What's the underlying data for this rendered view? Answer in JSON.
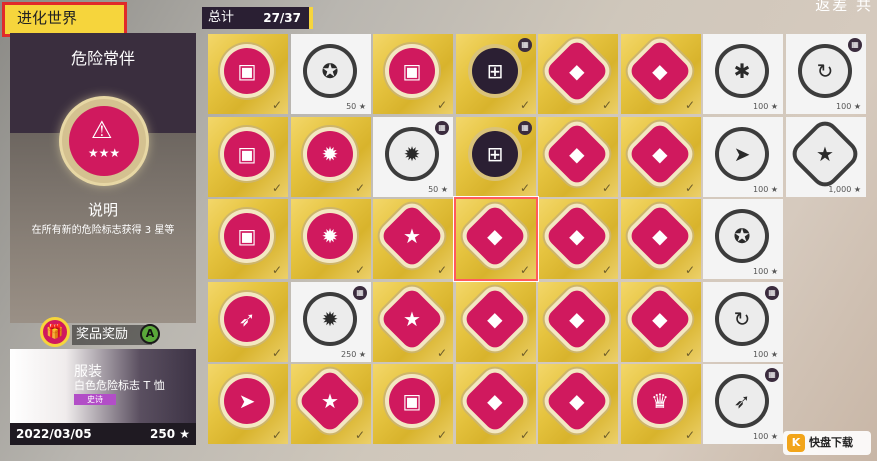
{
  "header": {
    "title": "进化世界",
    "total_label": "总计",
    "total_value": "27/37",
    "corner_text": "返差 共"
  },
  "detail": {
    "title": "危险常伴",
    "badge_icon": "warning-triangle-icon",
    "description_heading": "说明",
    "description_text": "在所有新的危险标志获得 3 星等"
  },
  "reward": {
    "label": "奖品奖励",
    "button_hint": "A",
    "type": "服装",
    "name": "白色危险标志 T 恤",
    "rarity": "史诗",
    "date": "2022/03/05",
    "points": "250 ★"
  },
  "tiles": [
    {
      "style": "gold",
      "badge": "pink",
      "icon": "▣",
      "done": true
    },
    {
      "style": "white",
      "badge": "grey",
      "icon": "✪",
      "pts": "50 ★"
    },
    {
      "style": "gold",
      "badge": "pink",
      "icon": "▣",
      "done": true
    },
    {
      "style": "gold",
      "badge": "dark",
      "icon": "⊞",
      "done": true,
      "gift": true
    },
    {
      "style": "gold",
      "badge": "pink",
      "icon": "◆",
      "shape": "hex",
      "done": true
    },
    {
      "style": "gold",
      "badge": "pink",
      "icon": "◆",
      "shape": "hex",
      "done": true
    },
    {
      "style": "white",
      "badge": "grey",
      "icon": "✱",
      "pts": "100 ★"
    },
    {
      "style": "white",
      "badge": "grey",
      "icon": "↻",
      "pts": "100 ★",
      "gift": true
    },
    {
      "style": "gold",
      "badge": "pink",
      "icon": "▣",
      "done": true
    },
    {
      "style": "gold",
      "badge": "pink",
      "icon": "✹",
      "done": true
    },
    {
      "style": "white",
      "badge": "grey",
      "icon": "✹",
      "pts": "50 ★",
      "gift": true
    },
    {
      "style": "gold",
      "badge": "dark",
      "icon": "⊞",
      "done": true,
      "gift": true
    },
    {
      "style": "gold",
      "badge": "pink",
      "icon": "◆",
      "shape": "hex",
      "done": true
    },
    {
      "style": "gold",
      "badge": "pink",
      "icon": "◆",
      "shape": "hex",
      "done": true
    },
    {
      "style": "white",
      "badge": "grey",
      "icon": "➤",
      "pts": "100 ★"
    },
    {
      "style": "white",
      "badge": "grey",
      "icon": "★",
      "shape": "hex",
      "pts": "1,000 ★"
    },
    {
      "style": "gold",
      "badge": "pink",
      "icon": "▣",
      "done": true
    },
    {
      "style": "gold",
      "badge": "pink",
      "icon": "✹",
      "done": true
    },
    {
      "style": "gold",
      "badge": "pink",
      "icon": "★",
      "shape": "hex",
      "done": true
    },
    {
      "style": "gold",
      "badge": "pink",
      "icon": "◆",
      "shape": "hex",
      "done": true,
      "selected": true
    },
    {
      "style": "gold",
      "badge": "pink",
      "icon": "◆",
      "shape": "hex",
      "done": true
    },
    {
      "style": "gold",
      "badge": "pink",
      "icon": "◆",
      "shape": "hex",
      "done": true
    },
    {
      "style": "white",
      "badge": "grey",
      "icon": "✪",
      "pts": "100 ★"
    },
    null,
    {
      "style": "gold",
      "badge": "pink",
      "icon": "➶",
      "done": true
    },
    {
      "style": "white",
      "badge": "grey",
      "icon": "✹",
      "pts": "250 ★",
      "gift": true
    },
    {
      "style": "gold",
      "badge": "pink",
      "icon": "★",
      "shape": "hex",
      "done": true
    },
    {
      "style": "gold",
      "badge": "pink",
      "icon": "◆",
      "shape": "hex",
      "done": true
    },
    {
      "style": "gold",
      "badge": "pink",
      "icon": "◆",
      "shape": "hex",
      "done": true
    },
    {
      "style": "gold",
      "badge": "pink",
      "icon": "◆",
      "shape": "hex",
      "done": true
    },
    {
      "style": "white",
      "badge": "grey",
      "icon": "↻",
      "pts": "100 ★",
      "gift": true
    },
    null,
    {
      "style": "gold",
      "badge": "pink",
      "icon": "➤",
      "done": true
    },
    {
      "style": "gold",
      "badge": "pink",
      "icon": "★",
      "shape": "hex",
      "done": true
    },
    {
      "style": "gold",
      "badge": "pink",
      "icon": "▣",
      "done": true
    },
    {
      "style": "gold",
      "badge": "pink",
      "icon": "◆",
      "shape": "hex",
      "done": true
    },
    {
      "style": "gold",
      "badge": "pink",
      "icon": "◆",
      "shape": "hex",
      "done": true
    },
    {
      "style": "gold",
      "badge": "pink",
      "icon": "♛",
      "done": true
    },
    {
      "style": "white",
      "badge": "grey",
      "icon": "➶",
      "pts": "100 ★",
      "gift": true
    },
    null
  ],
  "watermark": {
    "logo": "K",
    "text": "快盘下载"
  }
}
